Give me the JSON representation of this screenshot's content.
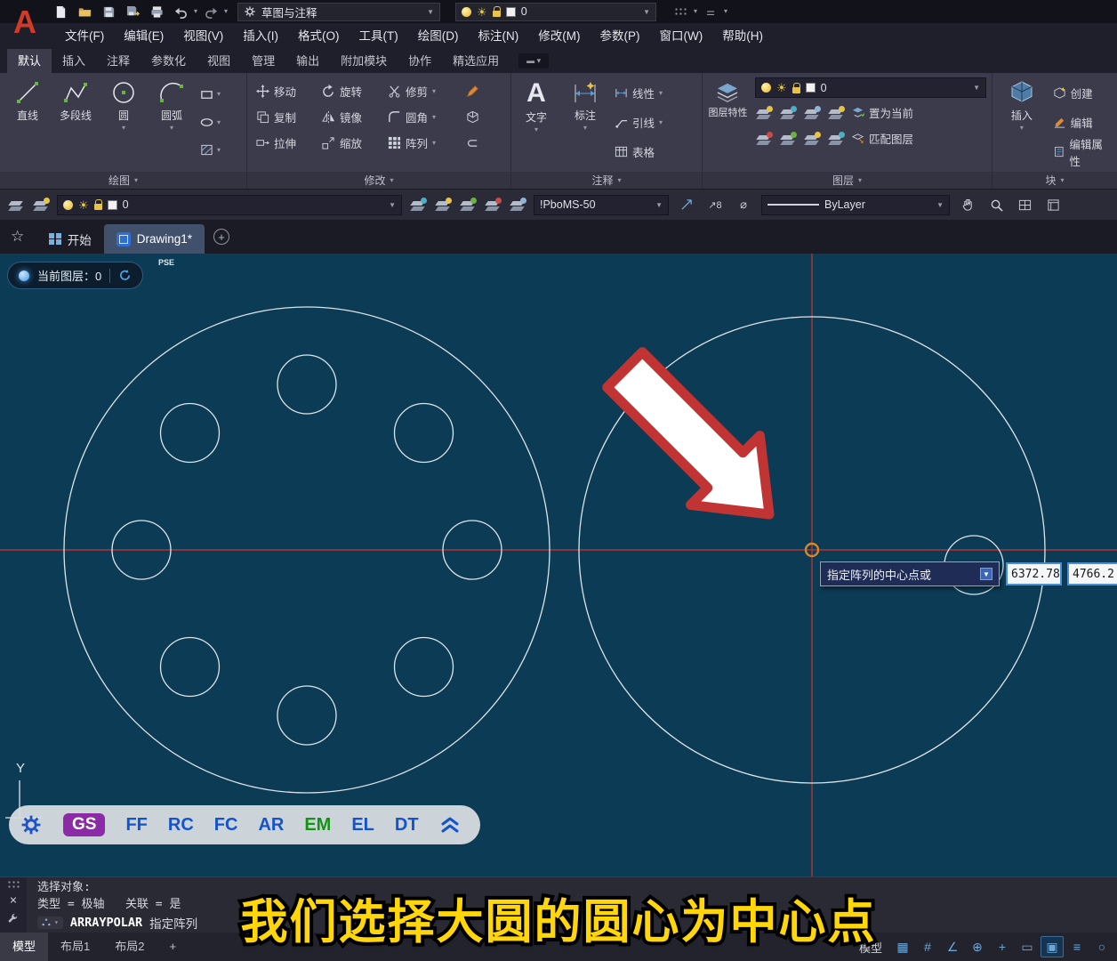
{
  "titlebar": {
    "workspace": "草图与注释",
    "layer_value": "0"
  },
  "menubar": {
    "items": [
      "文件(F)",
      "编辑(E)",
      "视图(V)",
      "插入(I)",
      "格式(O)",
      "工具(T)",
      "绘图(D)",
      "标注(N)",
      "修改(M)",
      "参数(P)",
      "窗口(W)",
      "帮助(H)"
    ]
  },
  "ribbon": {
    "tabs": [
      "默认",
      "插入",
      "注释",
      "参数化",
      "视图",
      "管理",
      "输出",
      "附加模块",
      "协作",
      "精选应用"
    ],
    "panels": {
      "draw": {
        "title": "绘图",
        "line": "直线",
        "polyline": "多段线",
        "circle": "圆",
        "arc": "圆弧"
      },
      "modify": {
        "title": "修改",
        "move": "移动",
        "rotate": "旋转",
        "trim": "修剪",
        "copy": "复制",
        "mirror": "镜像",
        "fillet": "圆角",
        "stretch": "拉伸",
        "scale": "缩放",
        "array": "阵列"
      },
      "annotate": {
        "title": "注释",
        "text": "文字",
        "dimension": "标注",
        "linear": "线性",
        "leader": "引线",
        "table": "表格"
      },
      "layers": {
        "title": "图层",
        "properties": "图层特性",
        "layer_value": "0",
        "make_current": "置为当前",
        "match": "匹配图层"
      },
      "block": {
        "title": "块",
        "insert": "插入",
        "create": "创建",
        "edit": "编辑",
        "edit_attr": "编辑属性"
      }
    }
  },
  "quickbar": {
    "layer_value": "0",
    "style_value": "!PboMS-50",
    "linetype_value": "ByLayer"
  },
  "filetabs": {
    "start": "开始",
    "drawing": "Drawing1*",
    "add": "+"
  },
  "canvas": {
    "layer_badge": "当前图层：0",
    "pse": "PSE",
    "axis_y": "Y",
    "tooltip_text": "指定阵列的中心点或",
    "coord_x": "6372.78",
    "coord_y": "4766.2",
    "shortcuts": {
      "gs": "GS",
      "ff": "FF",
      "rc": "RC",
      "fc": "FC",
      "ar": "AR",
      "em": "EM",
      "el": "EL",
      "dt": "DT"
    }
  },
  "command": {
    "line1": "选择对象:",
    "line2": "类型 = 极轴   关联 = 是",
    "cmd_name": "ARRAYPOLAR",
    "cmd_prompt": "指定阵列"
  },
  "statusbar": {
    "model_tab": "模型",
    "layout1_tab": "布局1",
    "layout2_tab": "布局2",
    "add_tab": "+",
    "model_label": "模型"
  },
  "subtitle": "我们选择大圆的圆心为中心点",
  "colors": {
    "canvas_background": "#0c3c55",
    "crosshair_red": "#b23535",
    "arrow_red": "#c13434",
    "subtitle_yellow": "#ffd60a",
    "shortcut_purple": "#8c2ba6",
    "shortcut_blue": "#1353cc",
    "shortcut_green": "#149414"
  }
}
